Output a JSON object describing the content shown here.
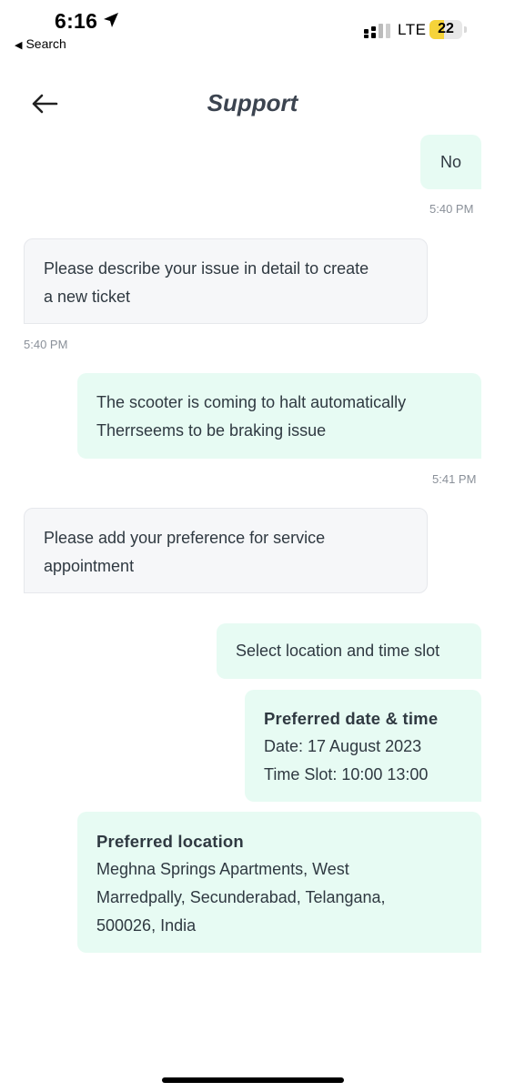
{
  "status_bar": {
    "time": "6:16",
    "back_app": "Search",
    "network": "LTE",
    "battery": "22"
  },
  "header": {
    "title": "Support"
  },
  "messages": [
    {
      "sender": "user",
      "text": "No",
      "time": "5:40 PM"
    },
    {
      "sender": "agent",
      "lines": [
        "Please describe your issue in detail to create",
        "a new ticket"
      ],
      "time": "5:40 PM"
    },
    {
      "sender": "user",
      "lines": [
        "The scooter is coming to halt automatically",
        "Therrseems to be braking issue"
      ],
      "time": "5:41 PM"
    },
    {
      "sender": "agent",
      "lines": [
        "Please add your preference for service",
        "appointment"
      ]
    },
    {
      "sender": "user",
      "text": "Select location and time slot"
    },
    {
      "sender": "user",
      "title": "Preferred date & time",
      "lines": [
        "Date: 17 August 2023",
        "Time Slot: 10:00 13:00"
      ]
    },
    {
      "sender": "user",
      "title": "Preferred location",
      "lines": [
        "Meghna Springs Apartments, West",
        "Marredpally, Secunderabad, Telangana,",
        "500026, India"
      ]
    }
  ]
}
